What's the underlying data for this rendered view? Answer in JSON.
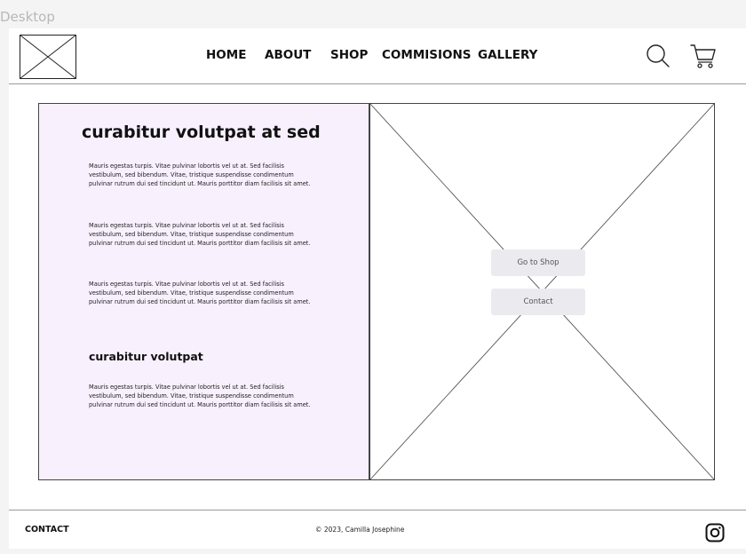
{
  "frame_label": "Desktop",
  "header": {
    "nav": [
      {
        "label": "HOME"
      },
      {
        "label": "ABOUT"
      },
      {
        "label": "SHOP"
      },
      {
        "label": "COMMISIONS"
      },
      {
        "label": "GALLERY"
      }
    ],
    "icons": [
      "logo-placeholder",
      "search-icon",
      "cart-icon"
    ]
  },
  "hero": {
    "title": "curabitur volutpat at sed",
    "paragraphs": [
      "Mauris egestas turpis. Vitae pulvinar lobortis vel ut at. Sed facilisis vestibulum, sed bibendum. Vitae, tristique suspendisse condimentum pulvinar rutrum dui sed tincidunt ut. Mauris porttitor diam facilisis sit amet.",
      "Mauris egestas turpis. Vitae pulvinar lobortis vel ut at. Sed facilisis vestibulum, sed bibendum. Vitae, tristique suspendisse condimentum pulvinar rutrum dui sed tincidunt ut. Mauris porttitor diam facilisis sit amet.",
      "Mauris egestas turpis. Vitae pulvinar lobortis vel ut at. Sed facilisis vestibulum, sed bibendum. Vitae, tristique suspendisse condimentum pulvinar rutrum dui sed tincidunt ut. Mauris porttitor diam facilisis sit amet."
    ],
    "subtitle": "curabitur volutpat",
    "sub_paragraph": "Mauris egestas turpis. Vitae pulvinar lobortis vel ut at. Sed facilisis vestibulum, sed bibendum. Vitae, tristique suspendisse condimentum pulvinar rutrum dui sed tincidunt ut. Mauris porttitor diam facilisis sit amet.",
    "buttons": [
      {
        "label": "Go to Shop"
      },
      {
        "label": "Contact"
      }
    ]
  },
  "footer": {
    "contact": "CONTACT",
    "copyright": "© 2023, Camilla Josephine",
    "icons": [
      "instagram-icon"
    ]
  },
  "colors": {
    "panel_bg": "#f8f0fd",
    "button_bg": "#ebebef",
    "rule": "#9a9a9a"
  }
}
